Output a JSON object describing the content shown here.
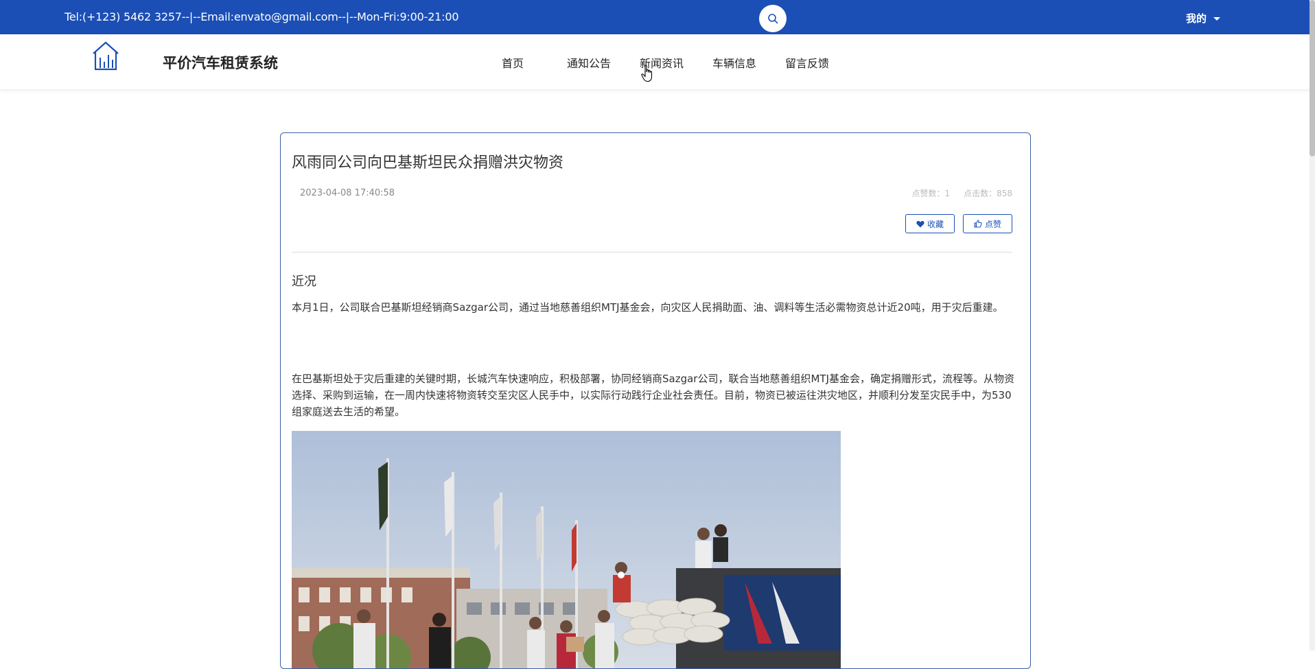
{
  "topbar": {
    "contact": "Tel:(+123) 5462 3257--|--Email:envato@gmail.com--|--Mon-Fri:9:00-21:00",
    "mine_label": "我的",
    "color": "#1b4fb5"
  },
  "header": {
    "site_title": "平价汽车租赁系统",
    "nav": [
      "首页",
      "通知公告",
      "新闻资讯",
      "车辆信息",
      "留言反馈"
    ]
  },
  "article": {
    "title": "风雨同公司向巴基斯坦民众捐赠洪灾物资",
    "date": "2023-04-08 17:40:58",
    "likes_label": "点赞数：1",
    "clicks_label": "点击数：858",
    "favorite_label": "收藏",
    "like_label": "点赞",
    "section_heading": "近况",
    "paragraph1": "本月1日，公司联合巴基斯坦经销商Sazgar公司，通过当地慈善组织MTJ基金会，向灾区人民捐助面、油、调料等生活必需物资总计近20吨，用于灾后重建。",
    "paragraph2": "在巴基斯坦处于灾后重建的关键时期，长城汽车快速响应，积极部署，协同经销商Sazgar公司，联合当地慈善组织MTJ基金会，确定捐赠形式，流程等。从物资选择、采购到运输，在一周内快速将物资转交至灾区人民手中，以实际行动践行企业社会责任。目前，物资已被运往洪灾地区，并顺利分发至灾民手中，为530组家庭送去生活的希望。"
  },
  "icons": {
    "logo": "building-chart-icon",
    "search": "search-icon",
    "favorite": "heart-icon",
    "like": "thumbs-up-icon"
  }
}
